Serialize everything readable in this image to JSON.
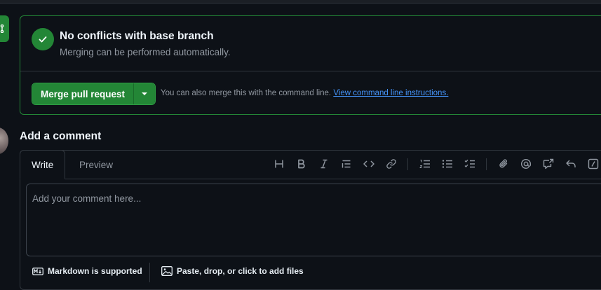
{
  "merge": {
    "status_title": "No conflicts with base branch",
    "status_subtitle": "Merging can be performed automatically.",
    "merge_button_label": "Merge pull request",
    "note_text": "You can also merge this with the command line. ",
    "note_link": "View command line instructions."
  },
  "comment": {
    "heading": "Add a comment",
    "tabs": {
      "write": "Write",
      "preview": "Preview"
    },
    "placeholder": "Add your comment here...",
    "footer": {
      "markdown_label": "Markdown is supported",
      "attach_label": "Paste, drop, or click to add files"
    },
    "toolbar_icons": [
      "heading-icon",
      "bold-icon",
      "italic-icon",
      "quote-icon",
      "code-icon",
      "link-icon",
      "numbered-list-icon",
      "unordered-list-icon",
      "task-list-icon",
      "attach-icon",
      "mention-icon",
      "reference-icon",
      "reply-icon",
      "slash-command-icon"
    ]
  },
  "colors": {
    "background": "#0d1117",
    "success": "#238636",
    "border": "#30363d",
    "link": "#4493f8",
    "muted": "#9198a1"
  }
}
